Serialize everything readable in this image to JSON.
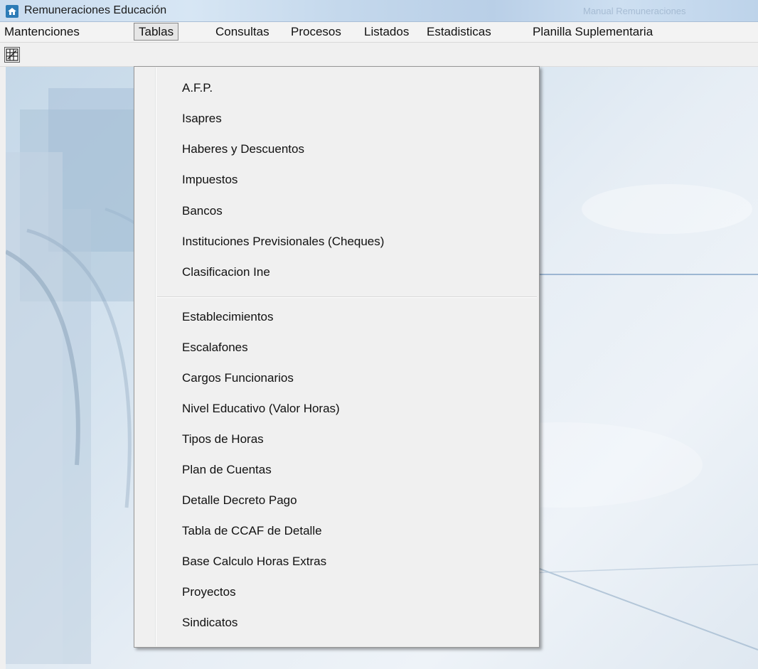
{
  "window": {
    "title": "Remuneraciones Educación",
    "background_caption": "Manual Remuneraciones"
  },
  "menubar": {
    "items": [
      {
        "label": "Mantenciones"
      },
      {
        "label": "Tablas",
        "active": true
      },
      {
        "label": "Consultas"
      },
      {
        "label": "Procesos"
      },
      {
        "label": "Listados"
      },
      {
        "label": "Estadisticas"
      },
      {
        "label": "Planilla Suplementaria"
      }
    ]
  },
  "toolbar": {
    "buttons": [
      {
        "icon": "grid-toolbar-icon"
      }
    ]
  },
  "tablas_menu": {
    "group1": [
      "A.F.P.",
      "Isapres",
      "Haberes y Descuentos",
      "Impuestos",
      "Bancos",
      "Instituciones Previsionales (Cheques)",
      "Clasificacion Ine"
    ],
    "group2": [
      "Establecimientos",
      "Escalafones",
      "Cargos Funcionarios",
      "Nivel Educativo (Valor Horas)",
      "Tipos de Horas",
      "Plan de Cuentas",
      "Detalle Decreto Pago",
      "Tabla de CCAF de Detalle",
      "Base Calculo Horas Extras",
      "Proyectos",
      "Sindicatos"
    ]
  },
  "colors": {
    "titlebar": "#c9dcef",
    "menu_bg": "#f0f0f0",
    "menu_border": "#979797",
    "text": "#111111"
  }
}
